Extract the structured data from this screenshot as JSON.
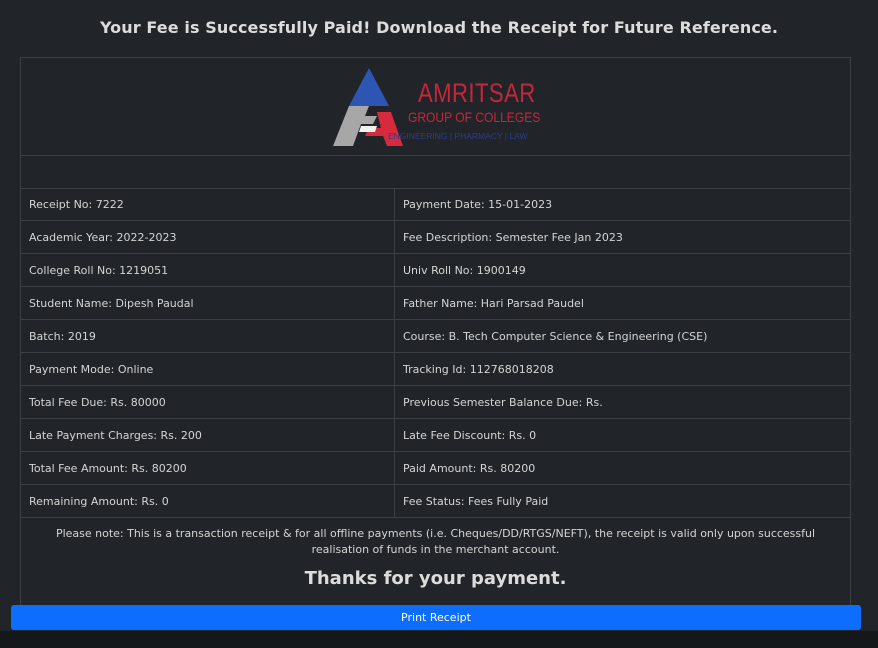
{
  "headline": "Your Fee is Successfully Paid! Download the Receipt for Future Reference.",
  "logo": {
    "title": "AMRITSAR",
    "subtitle": "GROUP OF COLLEGES",
    "tagline": "ENGINEERING | PHARMACY | LAW",
    "colors": {
      "blue": "#2d56b3",
      "red": "#d72a3c",
      "gray": "#a7a7a7"
    }
  },
  "rows": [
    {
      "left": "Receipt No: 7222",
      "right": "Payment Date: 15-01-2023"
    },
    {
      "left": "Academic Year: 2022-2023",
      "right": "Fee Description: Semester Fee Jan 2023"
    },
    {
      "left": "College Roll No: 1219051",
      "right": "Univ Roll No: 1900149"
    },
    {
      "left": "Student Name: Dipesh Paudal",
      "right": "Father Name: Hari Parsad Paudel"
    },
    {
      "left": "Batch: 2019",
      "right": "Course: B. Tech Computer Science & Engineering (CSE)"
    },
    {
      "left": "Payment Mode: Online",
      "right": "Tracking Id: 112768018208"
    },
    {
      "left": "Total Fee Due: Rs. 80000",
      "right": "Previous Semester Balance Due: Rs."
    },
    {
      "left": "Late Payment Charges: Rs. 200",
      "right": "Late Fee Discount: Rs. 0"
    },
    {
      "left": "Total Fee Amount: Rs. 80200",
      "right": "Paid Amount: Rs. 80200"
    },
    {
      "left": "Remaining Amount: Rs. 0",
      "right": "Fee Status: Fees Fully Paid"
    }
  ],
  "note": "Please note: This is a transaction receipt & for all offline payments (i.e. Cheques/DD/RTGS/NEFT), the receipt is valid only upon successful realisation of funds in the merchant account.",
  "thanks": "Thanks for your payment.",
  "print_button": "Print Receipt",
  "colors": {
    "background": "#212529",
    "border": "#3b4046",
    "button": "#0d6efd"
  }
}
